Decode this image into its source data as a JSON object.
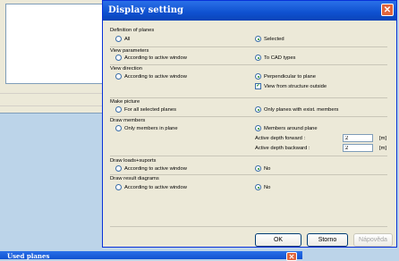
{
  "dialog": {
    "title": "Display setting",
    "close_icon": "close-icon",
    "sections": {
      "definition_of_planes": {
        "heading": "Definition of planes",
        "opt_left": "All",
        "opt_right": "Selected",
        "selected": "right"
      },
      "view_parameters": {
        "heading": "View parameters",
        "opt_left": "According to active window",
        "opt_right": "To CAD types",
        "selected": "right"
      },
      "view_direction": {
        "heading": "View direction",
        "opt_left": "According to active window",
        "opt_right": "Perpendicular to plane",
        "selected": "right",
        "checkbox_label": "View from structure outside",
        "checkbox_checked": true
      },
      "make_picture": {
        "heading": "Make picture",
        "opt_left": "For all selected planes",
        "opt_right": "Only planes with exist. members",
        "selected": "right"
      },
      "draw_members": {
        "heading": "Draw members",
        "opt_left": "Only members in plane",
        "opt_right": "Members around plane",
        "selected": "right",
        "depth_forward_label": "Active depth forward :",
        "depth_forward_value": "2",
        "depth_backward_label": "Active depth backward :",
        "depth_backward_value": "2",
        "unit": "[m]"
      },
      "draw_loads": {
        "heading": "Draw loads+suports",
        "opt_left": "According to active window",
        "opt_right": "No",
        "selected": "right"
      },
      "draw_result": {
        "heading": "Draw result diagrams",
        "opt_left": "According to active window",
        "opt_right": "No",
        "selected": "right"
      }
    },
    "buttons": {
      "ok": "OK",
      "storno": "Storno",
      "help": "Nápověda"
    }
  },
  "second_dialog": {
    "title": "Used planes"
  }
}
